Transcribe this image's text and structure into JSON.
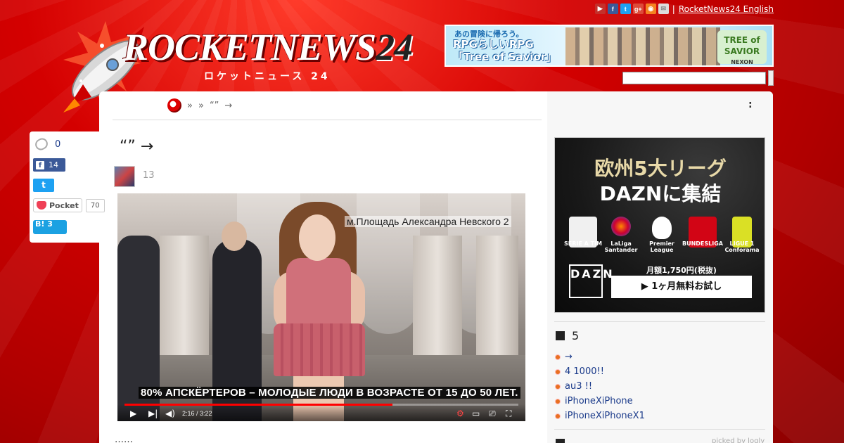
{
  "top": {
    "social_icons": [
      {
        "name": "youtube-icon",
        "label": "You",
        "color": "#c4302b"
      },
      {
        "name": "facebook-icon",
        "label": "f",
        "color": "#3b5998"
      },
      {
        "name": "twitter-icon",
        "label": "t",
        "color": "#1da1f2"
      },
      {
        "name": "googleplus-icon",
        "label": "g+",
        "color": "#dd4b39"
      },
      {
        "name": "rss-icon",
        "label": "rss",
        "color": "#f58220"
      },
      {
        "name": "mail-icon",
        "label": "✉",
        "color": "#bbbbbb"
      }
    ],
    "separator": "|",
    "english_link": "RocketNews24 English"
  },
  "logo": {
    "main": "ROCKETNEWS",
    "num": "24",
    "sub": "ロケットニュース 24"
  },
  "banner": {
    "line1": "あの冒険に帰ろう。",
    "line2": "RPGらしいRPG",
    "line3": "「Tree of Savior」",
    "brand": "TREE of SAVIOR",
    "publisher": "NEXON"
  },
  "breadcrumb": {
    "sep1": "»",
    "sep2": "»",
    "item": "“”",
    "arrow": "→",
    "colon": ":"
  },
  "share": {
    "clip_count": "0",
    "fb_count": "14",
    "pocket_label": "Pocket",
    "pocket_count": "70",
    "hatena_label": "B!",
    "hatena_count": "3"
  },
  "article": {
    "title": "“”  →",
    "date": "13",
    "more": "……"
  },
  "video": {
    "caption": "м.Площадь Александра Невского 2",
    "subtitle": "80% АПСКЁРТЕРОВ – МОЛОДЫЕ ЛЮДИ В ВОЗРАСТЕ ОТ 15 ДО 50 ЛЕТ.",
    "time": "2:16 / 3:22",
    "progress": 0.68
  },
  "ad": {
    "headline1": "欧州5大リーグ",
    "headline2": "DAZNに集結",
    "leagues": [
      "SERIE A TIM",
      "LaLiga Santander",
      "Premier League",
      "BUNDESLIGA",
      "LIGUE 1 Conforama"
    ],
    "logo": "DAZN",
    "price": "月額1,750円(税抜)",
    "cta": "▶ 1ヶ月無料お試し"
  },
  "sidebar": {
    "section_title": "5",
    "items": [
      "→",
      "4 1000!!",
      "au3  !!",
      "iPhoneXiPhone",
      "iPhoneXiPhoneX1"
    ],
    "picked": "picked by logly"
  }
}
